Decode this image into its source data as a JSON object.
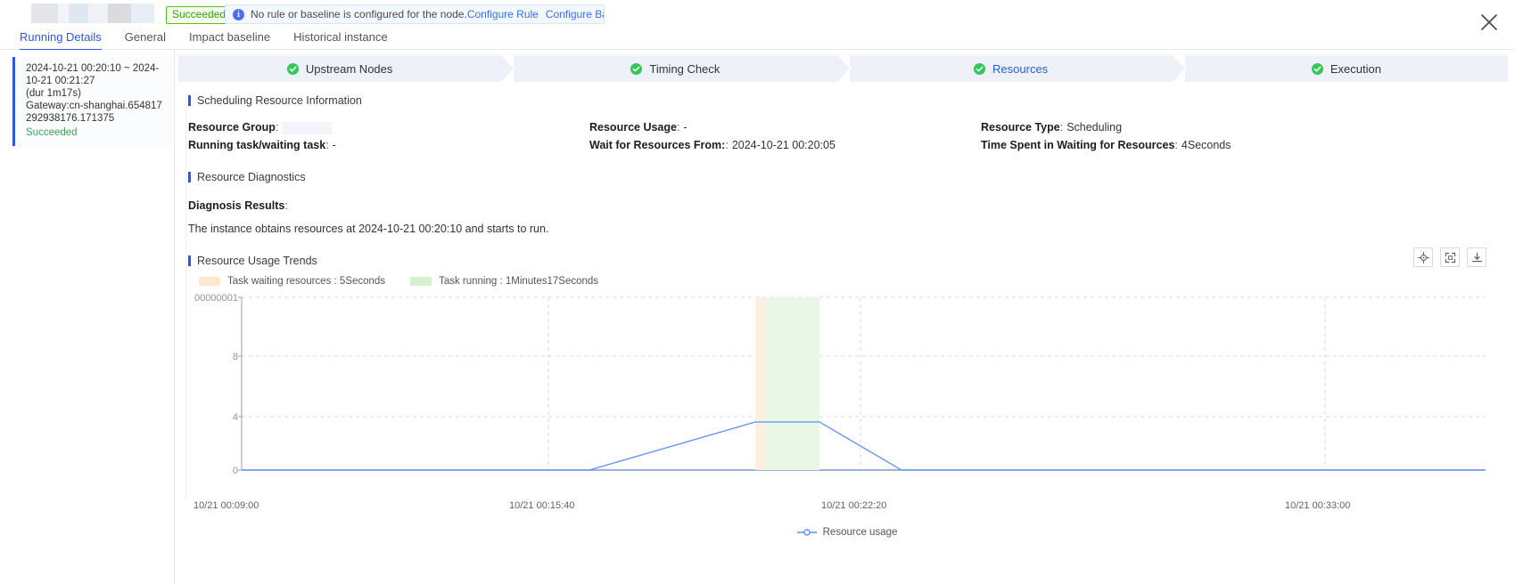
{
  "header": {
    "status_badge": "Succeeded",
    "notice_text": "No rule or baseline is configured for the node.",
    "notice_link_1": "Configure Rule",
    "notice_link_2": "Configure Baseline",
    "close_label": "×"
  },
  "tabs": [
    {
      "label": "Running Details",
      "active": true
    },
    {
      "label": "General",
      "active": false
    },
    {
      "label": "Impact baseline",
      "active": false
    },
    {
      "label": "Historical instance",
      "active": false
    }
  ],
  "sidebar": {
    "run": {
      "time_range": "2024-10-21 00:20:10 ~ 2024-10-21 00:21:27",
      "duration": "(dur 1m17s)",
      "gateway": "Gateway:cn-shanghai.654817292938176.171375",
      "status": "Succeeded"
    }
  },
  "steps": [
    {
      "label": "Upstream Nodes",
      "active": false
    },
    {
      "label": "Timing Check",
      "active": false
    },
    {
      "label": "Resources",
      "active": true
    },
    {
      "label": "Execution",
      "active": false
    }
  ],
  "scheduling": {
    "section_title": "Scheduling Resource Information",
    "resource_group_label": "Resource Group",
    "resource_group_value": "",
    "running_waiting_label": "Running task/waiting task",
    "running_waiting_value": "-",
    "resource_usage_label": "Resource Usage",
    "resource_usage_value": "-",
    "wait_from_label": "Wait for Resources From:",
    "wait_from_value": "2024-10-21 00:20:05",
    "resource_type_label": "Resource Type",
    "resource_type_value": "Scheduling",
    "time_spent_label": "Time Spent in Waiting for Resources",
    "time_spent_value": "4Seconds",
    "colon": ":"
  },
  "diagnostics": {
    "section_title": "Resource Diagnostics",
    "results_label": "Diagnosis Results",
    "results_text": "The instance obtains resources at 2024-10-21 00:20:10 and starts to run."
  },
  "trends": {
    "section_title": "Resource Usage Trends",
    "tools": [
      {
        "name": "target-icon",
        "title": "Locate"
      },
      {
        "name": "fullscreen-icon",
        "title": "Zoom"
      },
      {
        "name": "download-icon",
        "title": "Download"
      }
    ]
  },
  "chart_data": {
    "type": "line",
    "title": "Resource Usage Trends",
    "xlabel": "",
    "ylabel": "",
    "legend_position": "bottom",
    "grid": true,
    "series": [
      {
        "name": "Resource usage",
        "color": "#5b8ff9",
        "x": [
          "10/21 00:09:00",
          "10/21 00:18:20",
          "10/21 00:20:05",
          "10/21 00:22:20",
          "10/21 00:25:00",
          "10/21 00:33:00"
        ],
        "values": [
          0,
          0,
          3,
          3,
          0,
          0
        ]
      }
    ],
    "x_ticks": [
      "10/21 00:09:00",
      "10/21 00:15:40",
      "10/21 00:22:20",
      "10/21 00:33:00"
    ],
    "y_ticks": [
      "0",
      "4",
      "8",
      "00000001"
    ],
    "ylim": [
      0,
      12
    ],
    "bands": [
      {
        "name": "Task waiting resources",
        "label": "Task waiting resources : 5Seconds",
        "color": "#fde8cd",
        "start": "10/21 00:20:00",
        "end": "10/21 00:20:10"
      },
      {
        "name": "Task running",
        "label": "Task running : 1Minutes17Seconds",
        "color": "#d7f0cd",
        "start": "10/21 00:20:10",
        "end": "10/21 00:21:27"
      }
    ],
    "legend": [
      "Resource usage"
    ]
  },
  "colors": {
    "accent": "#2a5bd7",
    "success": "#52c41a",
    "section_bar": "#2f54eb",
    "line": "#5b8ff9",
    "band_wait": "#fde8cd",
    "band_run": "#d7f0cd"
  }
}
